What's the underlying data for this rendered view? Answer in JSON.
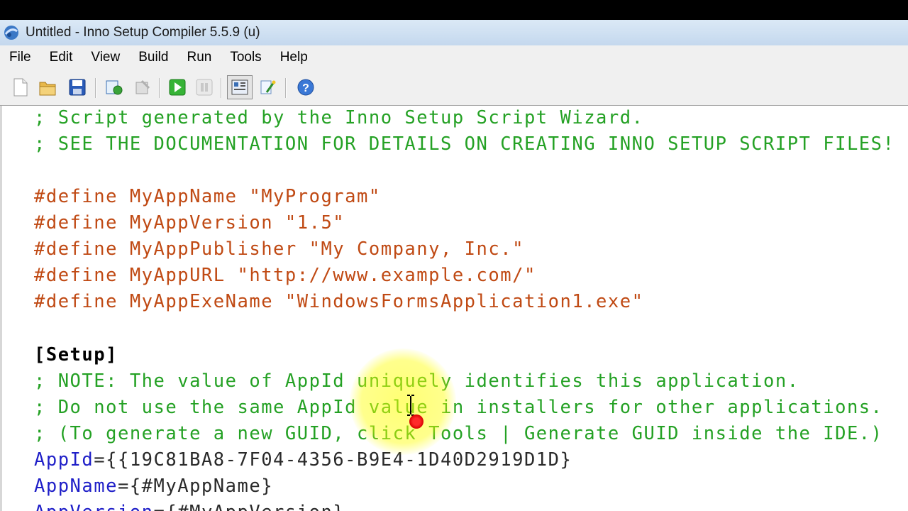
{
  "window": {
    "title": "Untitled - Inno Setup Compiler 5.5.9 (u)"
  },
  "menu": [
    "File",
    "Edit",
    "View",
    "Build",
    "Run",
    "Tools",
    "Help"
  ],
  "toolbar_icons": [
    "new-file-icon",
    "open-folder-icon",
    "save-icon",
    "compile-icon",
    "stop-compile-icon",
    "run-icon",
    "pause-icon",
    "target-settings-icon",
    "wizard-icon",
    "help-icon"
  ],
  "code": {
    "l1": "; Script generated by the Inno Setup Script Wizard.",
    "l2": "; SEE THE DOCUMENTATION FOR DETAILS ON CREATING INNO SETUP SCRIPT FILES!",
    "l3": "#define MyAppName \"MyProgram\"",
    "l4": "#define MyAppVersion \"1.5\"",
    "l5": "#define MyAppPublisher \"My Company, Inc.\"",
    "l6": "#define MyAppURL \"http://www.example.com/\"",
    "l7": "#define MyAppExeName \"WindowsFormsApplication1.exe\"",
    "l8": "[Setup]",
    "l9": "; NOTE: The value of AppId uniquely identifies this application.",
    "l10": "; Do not use the same AppId value in installers for other applications.",
    "l11": "; (To generate a new GUID, click Tools | Generate GUID inside the IDE.)",
    "l12_key": "AppId",
    "l12_val": "={{19C81BA8-7F04-4356-B9E4-1D40D2919D1D}",
    "l13_key": "AppName",
    "l13_val": "={#MyAppName}",
    "l14_key": "AppVersion",
    "l14_val": "={#MyAppVersion}"
  }
}
